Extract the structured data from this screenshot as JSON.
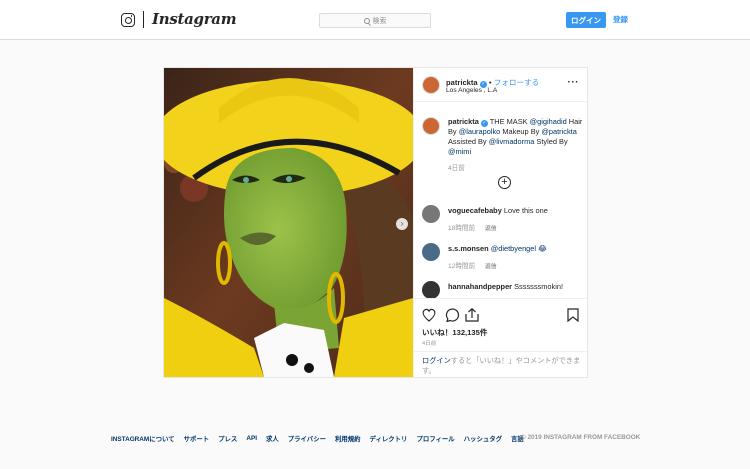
{
  "header": {
    "wordmark": "Instagram",
    "search_placeholder": "検索",
    "login_label": "ログイン",
    "signup_label": "登録"
  },
  "post": {
    "author": "patrickta",
    "follow_label": "フォローする",
    "location": "Los Angeles , L.A",
    "caption": {
      "mention1": "THE MASK",
      "tag1": "@gigihadid",
      "part2": "Hair By",
      "tag2": "@laurapolko",
      "part3": "Makeup By",
      "tag3": "@patrickta",
      "part4": "Assisted By",
      "tag4": "@livmadorma",
      "part5": "Styled By",
      "tag5": "@mimi",
      "time": "4日前"
    },
    "comments": [
      {
        "user": "voguecafebaby",
        "text": "Love this one",
        "time": "18時間前",
        "reply": "返信"
      },
      {
        "user": "s.s.monsen",
        "text": "@dietbyengel 😂",
        "time": "12時間前",
        "reply": "返信"
      },
      {
        "user": "hannahandpepper",
        "text": "Sssssssmokin!"
      }
    ],
    "likes": "いいね！132,135件",
    "date": "4日前",
    "login_prompt": {
      "link": "ログイン",
      "text": "すると「いいね！」やコメントができます。"
    }
  },
  "footer": {
    "links": [
      "INSTAGRAMについて",
      "サポート",
      "プレス",
      "API",
      "求人",
      "プライバシー",
      "利用規約",
      "ディレクトリ",
      "プロフィール",
      "ハッシュタグ",
      "言語"
    ],
    "copyright": "© 2019 INSTAGRAM FROM FACEBOOK"
  },
  "colors": {
    "accent": "#3897f0",
    "link": "#003569",
    "hat_yellow": "#f2d21a",
    "skin_green": "#8cb43a"
  }
}
